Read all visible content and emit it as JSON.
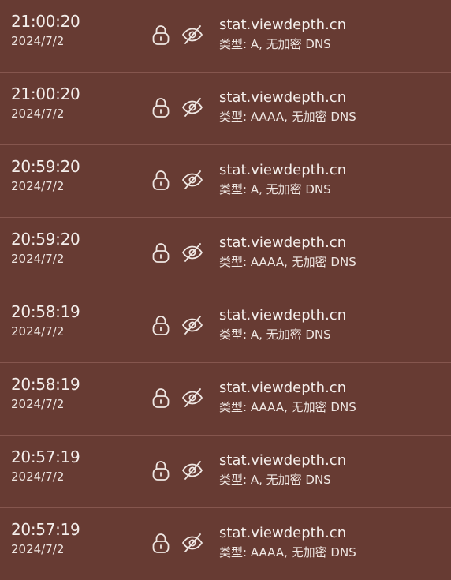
{
  "colors": {
    "background": "#673b33",
    "divider": "#85564e",
    "text": "#f2ece9"
  },
  "icons": {
    "lock": "lock-icon",
    "eye_slash": "eye-slash-icon"
  },
  "entries": [
    {
      "time": "21:00:20",
      "date": "2024/7/2",
      "domain": "stat.viewdepth.cn",
      "info": "类型: A, 无加密 DNS"
    },
    {
      "time": "21:00:20",
      "date": "2024/7/2",
      "domain": "stat.viewdepth.cn",
      "info": "类型: AAAA, 无加密 DNS"
    },
    {
      "time": "20:59:20",
      "date": "2024/7/2",
      "domain": "stat.viewdepth.cn",
      "info": "类型: A, 无加密 DNS"
    },
    {
      "time": "20:59:20",
      "date": "2024/7/2",
      "domain": "stat.viewdepth.cn",
      "info": "类型: AAAA, 无加密 DNS"
    },
    {
      "time": "20:58:19",
      "date": "2024/7/2",
      "domain": "stat.viewdepth.cn",
      "info": "类型: A, 无加密 DNS"
    },
    {
      "time": "20:58:19",
      "date": "2024/7/2",
      "domain": "stat.viewdepth.cn",
      "info": "类型: AAAA, 无加密 DNS"
    },
    {
      "time": "20:57:19",
      "date": "2024/7/2",
      "domain": "stat.viewdepth.cn",
      "info": "类型: A, 无加密 DNS"
    },
    {
      "time": "20:57:19",
      "date": "2024/7/2",
      "domain": "stat.viewdepth.cn",
      "info": "类型: AAAA, 无加密 DNS"
    }
  ]
}
